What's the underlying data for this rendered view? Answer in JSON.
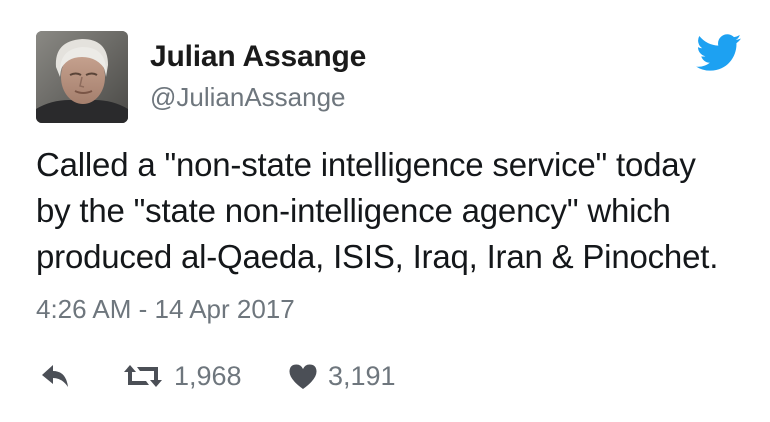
{
  "author": {
    "display_name": "Julian Assange",
    "handle": "@JulianAssange",
    "avatar_icon": "profile-photo"
  },
  "brand": {
    "icon": "twitter-bird-icon",
    "color": "#1da1f2"
  },
  "tweet": {
    "lines": [
      "Called a \"non-state intelligence service\" today",
      "by the \"state non-intelligence agency\" which",
      "produced al-Qaeda, ISIS, Iraq, Iran & Pinochet."
    ],
    "timestamp": "4:26 AM - 14 Apr 2017"
  },
  "actions": {
    "reply_icon": "reply-icon",
    "retweet_icon": "retweet-icon",
    "retweet_count": "1,968",
    "like_icon": "heart-icon",
    "like_count": "3,191",
    "icon_color": "#4b4f56"
  }
}
